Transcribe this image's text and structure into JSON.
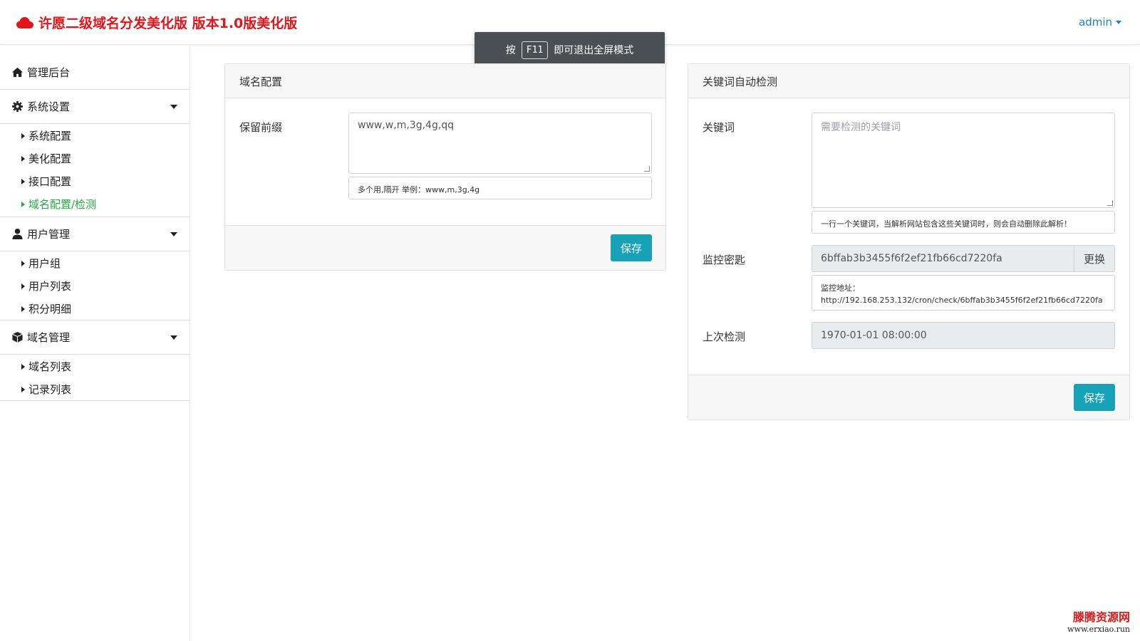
{
  "header": {
    "brand_title": "许愿二级域名分发美化版 版本1.0版美化版",
    "user_menu": "admin"
  },
  "toast": {
    "prefix": "按",
    "key": "F11",
    "suffix": "即可退出全屏模式"
  },
  "sidebar": {
    "dashboard": "管理后台",
    "system_settings": "系统设置",
    "system_items": [
      "系统配置",
      "美化配置",
      "接口配置",
      "域名配置/检测"
    ],
    "user_management": "用户管理",
    "user_items": [
      "用户组",
      "用户列表",
      "积分明细"
    ],
    "domain_management": "域名管理",
    "domain_items": [
      "域名列表",
      "记录列表"
    ]
  },
  "domain_config": {
    "title": "域名配置",
    "reserved_prefix_label": "保留前缀",
    "reserved_prefix_value": "www,w,m,3g,4g,qq",
    "reserved_prefix_help": "多个用,隔开 举例：www,m,3g,4g",
    "save_label": "保存"
  },
  "keyword_check": {
    "title": "关键词自动检测",
    "keyword_label": "关键词",
    "keyword_placeholder": "需要检测的关键词",
    "keyword_help": "一行一个关键词，当解析网站包含这些关键词时，则会自动删除此解析！",
    "monitor_key_label": "监控密匙",
    "monitor_key_value": "6bffab3b3455f6f2ef21fb66cd7220fa",
    "change_label": "更换",
    "monitor_url_label": "监控地址：",
    "monitor_url_value": "http://192.168.253.132/cron/check/6bffab3b3455f6f2ef21fb66cd7220fa",
    "last_check_label": "上次检测",
    "last_check_value": "1970-01-01 08:00:00",
    "save_label": "保存"
  },
  "watermark": {
    "line1": "滕腾资源网",
    "line2": "www.erxiao.run"
  },
  "colors": {
    "brand_red": "#e0161c",
    "link_blue": "#1f7fc4",
    "active_green": "#28a745",
    "button_teal": "#17a2b8"
  }
}
